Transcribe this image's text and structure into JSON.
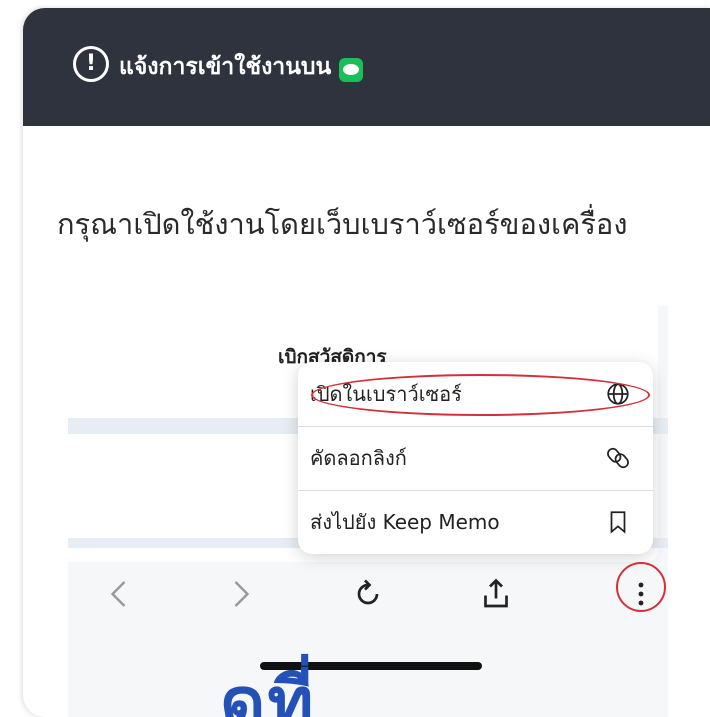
{
  "header": {
    "title": "แจ้งการเข้าใช้งานบน",
    "warn_symbol": "!",
    "line_icon": "line-app-icon"
  },
  "message": "กรุณาเปิดใช้งานโดยเว็บเบราว์เซอร์ของเครื่อง",
  "screenshot": {
    "page_heading": "เบิกสวัสดิการ",
    "menu": [
      {
        "label": "เปิดในเบราว์เซอร์",
        "icon": "globe-icon",
        "highlighted": true
      },
      {
        "label": "คัดลอกลิงก์",
        "icon": "link-icon"
      },
      {
        "label": "ส่งไปยัง Keep Memo",
        "icon": "bookmark-icon"
      }
    ],
    "toolbar": [
      "back-icon",
      "forward-icon",
      "refresh-icon",
      "share-icon",
      "more-icon"
    ],
    "highlight_color": "#d2313b"
  },
  "bottom_text": "ดูที่"
}
